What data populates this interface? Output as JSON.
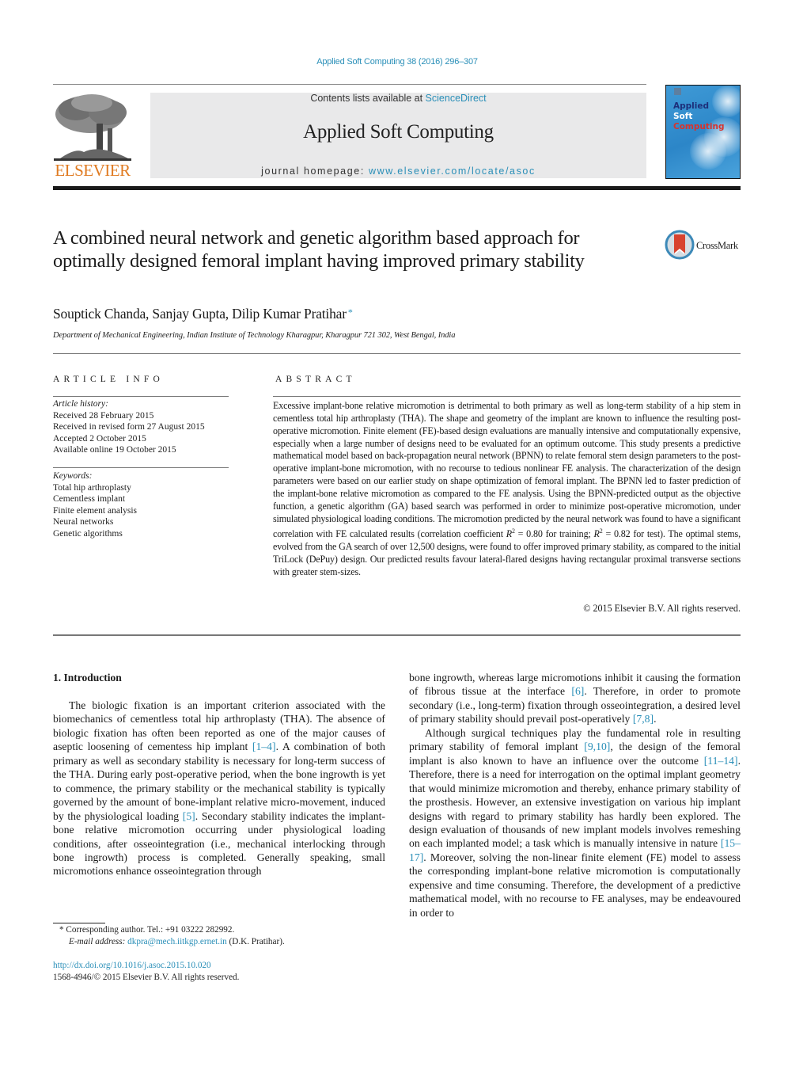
{
  "citation": "Applied Soft Computing 38 (2016) 296–307",
  "header": {
    "publisher": "ELSEVIER",
    "contents_prefix": "Contents lists available at ",
    "contents_link": "ScienceDirect",
    "journal_name": "Applied Soft Computing",
    "homepage_prefix": "journal homepage: ",
    "homepage_link": "www.elsevier.com/locate/asoc",
    "cover": {
      "line1": "Applied",
      "line2": "Soft",
      "line3": "Computing",
      "colors": {
        "background": "#2c86c8",
        "line1": "#1d2f7a",
        "line2": "#ffffff",
        "line3": "#d8332d"
      }
    }
  },
  "article": {
    "title": "A combined neural network and genetic algorithm based approach for optimally designed femoral implant having improved primary stability",
    "crossmark_label": "CrossMark",
    "authors": "Souptick Chanda, Sanjay Gupta, Dilip Kumar Pratihar",
    "corresponding_marker": "*",
    "affiliation": "Department of Mechanical Engineering, Indian Institute of Technology Kharagpur, Kharagpur 721 302, West Bengal, India"
  },
  "article_info": {
    "heading": "ARTICLE INFO",
    "history_label": "Article history:",
    "history": [
      "Received 28 February 2015",
      "Received in revised form 27 August 2015",
      "Accepted 2 October 2015",
      "Available online 19 October 2015"
    ],
    "keywords_label": "Keywords:",
    "keywords": [
      "Total hip arthroplasty",
      "Cementless implant",
      "Finite element analysis",
      "Neural networks",
      "Genetic algorithms"
    ]
  },
  "abstract": {
    "heading": "ABSTRACT",
    "text_part1": "Excessive implant-bone relative micromotion is detrimental to both primary as well as long-term stability of a hip stem in cementless total hip arthroplasty (THA). The shape and geometry of the implant are known to influence the resulting post-operative micromotion. Finite element (FE)-based design evaluations are manually intensive and computationally expensive, especially when a large number of designs need to be evaluated for an optimum outcome. This study presents a predictive mathematical model based on back-propagation neural network (BPNN) to relate femoral stem design parameters to the post-operative implant-bone micromotion, with no recourse to tedious nonlinear FE analysis. The characterization of the design parameters were based on our earlier study on shape optimization of femoral implant. The BPNN led to faster prediction of the implant-bone relative micromotion as compared to the FE analysis. Using the BPNN-predicted output as the objective function, a genetic algorithm (GA) based search was performed in order to minimize post-operative micromotion, under simulated physiological loading conditions. The micromotion predicted by the neural network was found to have a significant correlation with FE calculated results (correlation coefficient ",
    "r2_symbol": "R",
    "r2_exp": "2",
    "r2_training": " = 0.80 for training; ",
    "r2_test": " = 0.82 for test). The optimal stems, evolved from the GA search of over 12,500 designs, were found to offer improved primary stability, as compared to the initial TriLock (DePuy) design. Our predicted results favour lateral-flared designs having rectangular proximal transverse sections with greater stem-sizes.",
    "copyright": "© 2015 Elsevier B.V. All rights reserved."
  },
  "introduction": {
    "heading": "1.  Introduction",
    "left": {
      "p1_a": "The biologic fixation is an important criterion associated with the biomechanics of cementless total hip arthroplasty (THA). The absence of biologic fixation has often been reported as one of the major causes of aseptic loosening of cementess hip implant ",
      "ref1": "[1–4]",
      "p1_b": ". A combination of both primary as well as secondary stability is necessary for long-term success of the THA. During early post-operative period, when the bone ingrowth is yet to commence, the primary stability or the mechanical stability is typically governed by the amount of bone-implant relative micro-movement, induced by the physiological loading ",
      "ref2": "[5]",
      "p1_c": ". Secondary stability indicates the implant-bone relative micromotion occurring under physiological loading conditions, after osseointegration (i.e., mechanical interlocking through bone ingrowth) process is completed. Generally speaking, small micromotions enhance osseointegration through"
    },
    "right": {
      "p1_a": "bone ingrowth, whereas large micromotions inhibit it causing the formation of fibrous tissue at the interface ",
      "ref1": "[6]",
      "p1_b": ". Therefore, in order to promote secondary (i.e., long-term) fixation through osseointegration, a desired level of primary stability should prevail post-operatively ",
      "ref2": "[7,8]",
      "p1_c": ".",
      "p2_a": "Although surgical techniques play the fundamental role in resulting primary stability of femoral implant ",
      "ref3": "[9,10]",
      "p2_b": ", the design of the femoral implant is also known to have an influence over the outcome ",
      "ref4": "[11–14]",
      "p2_c": ". Therefore, there is a need for interrogation on the optimal implant geometry that would minimize micromotion and thereby, enhance primary stability of the prosthesis. However, an extensive investigation on various hip implant designs with regard to primary stability has hardly been explored. The design evaluation of thousands of new implant models involves remeshing on each implanted model; a task which is manually intensive in nature ",
      "ref5": "[15–17]",
      "p2_d": ". Moreover, solving the non-linear finite element (FE) model to assess the corresponding implant-bone relative micromotion is computationally expensive and time consuming. Therefore, the development of a predictive mathematical model, with no recourse to FE analyses, may be endeavoured in order to"
    }
  },
  "footnote": {
    "marker": "*",
    "corresponding": " Corresponding author. Tel.: +91 03222 282992.",
    "email_label": "E-mail address: ",
    "email": "dkpra@mech.iitkgp.ernet.in",
    "email_suffix": " (D.K. Pratihar).",
    "doi": "http://dx.doi.org/10.1016/j.asoc.2015.10.020",
    "issn_line": "1568-4946/© 2015 Elsevier B.V. All rights reserved."
  },
  "colors": {
    "link": "#2a8fb8",
    "publisher_orange": "#e07b22",
    "masthead_bg": "#e9e9ea"
  }
}
